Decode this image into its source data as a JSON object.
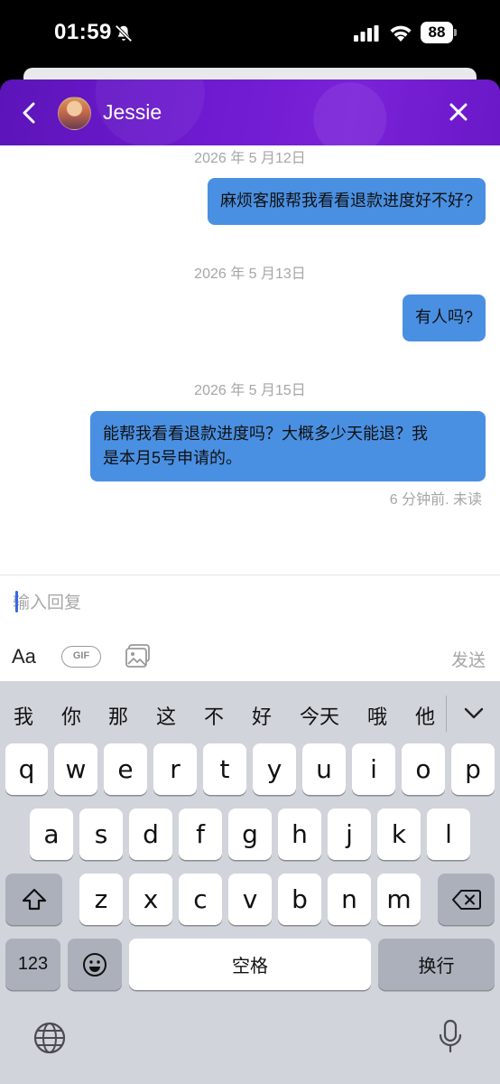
{
  "status_bar": {
    "time": "01:59",
    "battery": "88"
  },
  "header": {
    "contact_name": "Jessie"
  },
  "messages": [
    {
      "date": "2026 年 5 月12日",
      "text": "麻烦客服帮我看看退款进度好不好?"
    },
    {
      "date": "2026 年 5 月13日",
      "text": "有人吗?"
    },
    {
      "date": "2026 年 5 月15日",
      "text_line1": "能帮我看看退款进度吗？大概多少天能退？我",
      "text_line2": "是本月5号申请的。"
    }
  ],
  "message_meta": "6 分钟前. 未读",
  "composer": {
    "placeholder": "输入回复",
    "aa_label": "Aa",
    "gif_label": "GIF",
    "send_label": "发送"
  },
  "keyboard": {
    "candidates": [
      "我",
      "你",
      "那",
      "这",
      "不",
      "好",
      "今天",
      "哦",
      "他"
    ],
    "row1": [
      "q",
      "w",
      "e",
      "r",
      "t",
      "y",
      "u",
      "i",
      "o",
      "p"
    ],
    "row2": [
      "a",
      "s",
      "d",
      "f",
      "g",
      "h",
      "j",
      "k",
      "l"
    ],
    "row3": [
      "z",
      "x",
      "c",
      "v",
      "b",
      "n",
      "m"
    ],
    "numbers_label": "123",
    "space_label": "空格",
    "return_label": "换行"
  },
  "icons": {
    "status": [
      "bell-off-icon",
      "signal-icon",
      "wifi-icon",
      "battery-icon"
    ],
    "header": [
      "back-icon",
      "avatar",
      "close-icon"
    ],
    "composer": [
      "image-icon"
    ],
    "keyboard": [
      "chevron-down-icon",
      "shift-icon",
      "delete-icon",
      "emoji-icon",
      "globe-icon",
      "microphone-icon"
    ]
  },
  "colors": {
    "header_gradient": "#6e1ad0",
    "bubble": "#4a90e2",
    "keyboard_bg": "#d1d4db"
  }
}
